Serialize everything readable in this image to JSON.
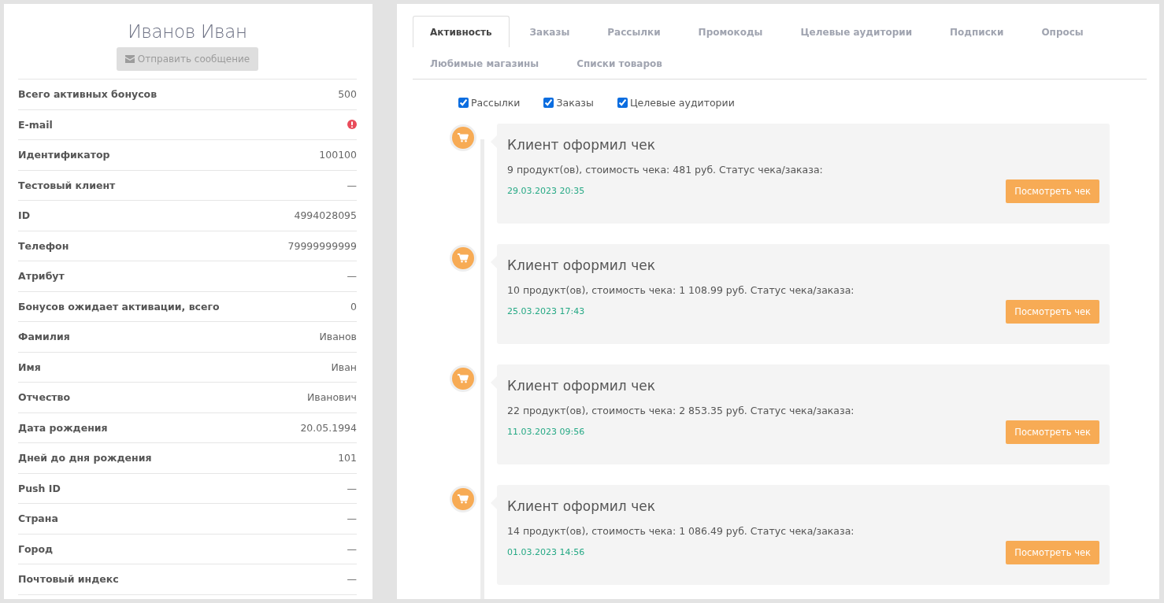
{
  "profile": {
    "name": "Иванов Иван",
    "send_button": {
      "label": "Отправить сообщение",
      "disabled": true
    },
    "fields": [
      {
        "kind": "text",
        "label": "Всего активных бонусов",
        "value": "500"
      },
      {
        "kind": "warning",
        "label": "E-mail"
      },
      {
        "kind": "text",
        "label": "Идентификатор",
        "value": "100100"
      },
      {
        "kind": "text",
        "label": "Тестовый клиент",
        "value": "—"
      },
      {
        "kind": "text",
        "label": "ID",
        "value": "4994028095"
      },
      {
        "kind": "text",
        "label": "Телефон",
        "value": "79999999999"
      },
      {
        "kind": "text",
        "label": "Атрибут",
        "value": "—"
      },
      {
        "kind": "text",
        "label": "Бонусов ожидает активации, всего",
        "value": "0"
      },
      {
        "kind": "text",
        "label": "Фамилия",
        "value": "Иванов"
      },
      {
        "kind": "text",
        "label": "Имя",
        "value": "Иван"
      },
      {
        "kind": "text",
        "label": "Отчество",
        "value": "Иванович"
      },
      {
        "kind": "text",
        "label": "Дата рождения",
        "value": "20.05.1994"
      },
      {
        "kind": "text",
        "label": "Дней до дня рождения",
        "value": "101"
      },
      {
        "kind": "text",
        "label": "Push ID",
        "value": "—"
      },
      {
        "kind": "text",
        "label": "Страна",
        "value": "—"
      },
      {
        "kind": "text",
        "label": "Город",
        "value": "—"
      },
      {
        "kind": "text",
        "label": "Почтовый индекс",
        "value": "—"
      }
    ]
  },
  "tabs": [
    {
      "label": "Активность",
      "selected": true
    },
    {
      "label": "Заказы",
      "selected": false
    },
    {
      "label": "Рассылки",
      "selected": false
    },
    {
      "label": "Промокоды",
      "selected": false
    },
    {
      "label": "Целевые аудитории",
      "selected": false
    },
    {
      "label": "Подписки",
      "selected": false
    },
    {
      "label": "Опросы",
      "selected": false
    },
    {
      "label": "Любимые магазины",
      "selected": false
    },
    {
      "label": "Списки товаров",
      "selected": false
    }
  ],
  "filters": [
    {
      "label": "Рассылки",
      "checked": true
    },
    {
      "label": "Заказы",
      "checked": true
    },
    {
      "label": "Целевые аудитории",
      "checked": true
    }
  ],
  "events": [
    {
      "title": "Клиент оформил чек",
      "details": "9 продукт(ов), стоимость чека: 481 руб. Статус чека/заказа:",
      "date": "29.03.2023 20:35",
      "button": "Посмотреть чек"
    },
    {
      "title": "Клиент оформил чек",
      "details": "10 продукт(ов), стоимость чека: 1 108.99 руб. Статус чека/заказа:",
      "date": "25.03.2023 17:43",
      "button": "Посмотреть чек"
    },
    {
      "title": "Клиент оформил чек",
      "details": "22 продукт(ов), стоимость чека: 2 853.35 руб. Статус чека/заказа:",
      "date": "11.03.2023 09:56",
      "button": "Посмотреть чек"
    },
    {
      "title": "Клиент оформил чек",
      "details": "14 продукт(ов), стоимость чека: 1 086.49 руб. Статус чека/заказа:",
      "date": "01.03.2023 14:56",
      "button": "Посмотреть чек"
    }
  ]
}
